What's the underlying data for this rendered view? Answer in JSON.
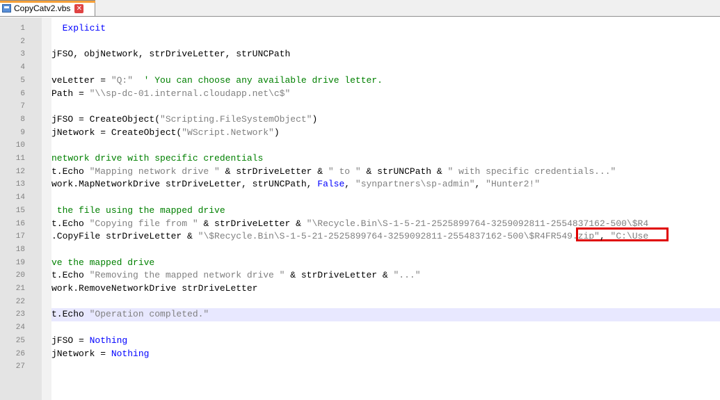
{
  "tab": {
    "filename": "CopyCatv2.vbs",
    "close_glyph": "✕"
  },
  "colors": {
    "keyword": "#0000ff",
    "string": "#808080",
    "comment": "#008000",
    "highlight_box": "#e00000",
    "current_line": "#e8e8ff"
  },
  "editor": {
    "current_line_number": 23,
    "line_numbers": [
      "1",
      "2",
      "3",
      "4",
      "5",
      "6",
      "7",
      "8",
      "9",
      "10",
      "11",
      "12",
      "13",
      "14",
      "15",
      "16",
      "17",
      "18",
      "19",
      "20",
      "21",
      "22",
      "23",
      "24",
      "25",
      "26",
      "27"
    ],
    "lines": [
      [
        {
          "t": "  Explicit",
          "c": "kw"
        }
      ],
      [],
      [
        {
          "t": "jFSO, objNetwork, strDriveLetter, strUNCPath",
          "c": ""
        }
      ],
      [],
      [
        {
          "t": "veLetter = ",
          "c": ""
        },
        {
          "t": "\"Q:\"",
          "c": "str"
        },
        {
          "t": "  ' You can choose any available drive letter.",
          "c": "cmt"
        }
      ],
      [
        {
          "t": "Path = ",
          "c": ""
        },
        {
          "t": "\"\\\\sp-dc-01.internal.cloudapp.net\\c$\"",
          "c": "str"
        }
      ],
      [],
      [
        {
          "t": "jFSO = CreateObject(",
          "c": ""
        },
        {
          "t": "\"Scripting.FileSystemObject\"",
          "c": "str"
        },
        {
          "t": ")",
          "c": ""
        }
      ],
      [
        {
          "t": "jNetwork = CreateObject(",
          "c": ""
        },
        {
          "t": "\"WScript.Network\"",
          "c": "str"
        },
        {
          "t": ")",
          "c": ""
        }
      ],
      [],
      [
        {
          "t": "network drive with specific credentials",
          "c": "cmt"
        }
      ],
      [
        {
          "t": "t.Echo ",
          "c": ""
        },
        {
          "t": "\"Mapping network drive \"",
          "c": "str"
        },
        {
          "t": " & strDriveLetter & ",
          "c": ""
        },
        {
          "t": "\" to \"",
          "c": "str"
        },
        {
          "t": " & strUNCPath & ",
          "c": ""
        },
        {
          "t": "\" with specific credentials...\"",
          "c": "str"
        }
      ],
      [
        {
          "t": "work.MapNetworkDrive strDriveLetter, strUNCPath, ",
          "c": ""
        },
        {
          "t": "False",
          "c": "kw"
        },
        {
          "t": ", ",
          "c": ""
        },
        {
          "t": "\"synpartners\\sp-admin\"",
          "c": "str"
        },
        {
          "t": ", ",
          "c": ""
        },
        {
          "t": "\"Hunter2!\"",
          "c": "str"
        }
      ],
      [],
      [
        {
          "t": " the file using the mapped drive",
          "c": "cmt"
        }
      ],
      [
        {
          "t": "t.Echo ",
          "c": ""
        },
        {
          "t": "\"Copying file from \"",
          "c": "str"
        },
        {
          "t": " & strDriveLetter & ",
          "c": ""
        },
        {
          "t": "\"\\Recycle.Bin\\S-1-5-21-2525899764-3259092811-2554837162-500\\$R4",
          "c": "str"
        }
      ],
      [
        {
          "t": ".CopyFile strDriveLetter & ",
          "c": ""
        },
        {
          "t": "\"\\$Recycle.Bin\\S-1-5-21-2525899764-3259092811-2554837162-500\\$R4FR549.zip\"",
          "c": "str"
        },
        {
          "t": ", ",
          "c": ""
        },
        {
          "t": "\"C:\\Use",
          "c": "str"
        }
      ],
      [],
      [
        {
          "t": "ve the mapped drive",
          "c": "cmt"
        }
      ],
      [
        {
          "t": "t.Echo ",
          "c": ""
        },
        {
          "t": "\"Removing the mapped network drive \"",
          "c": "str"
        },
        {
          "t": " & strDriveLetter & ",
          "c": ""
        },
        {
          "t": "\"...\"",
          "c": "str"
        }
      ],
      [
        {
          "t": "work.RemoveNetworkDrive strDriveLetter",
          "c": ""
        }
      ],
      [],
      [
        {
          "t": "t.Echo ",
          "c": ""
        },
        {
          "t": "\"Operation completed.\"",
          "c": "str"
        }
      ],
      [],
      [
        {
          "t": "jFSO = ",
          "c": ""
        },
        {
          "t": "Nothing",
          "c": "kw"
        }
      ],
      [
        {
          "t": "jNetwork = ",
          "c": ""
        },
        {
          "t": "Nothing",
          "c": "kw"
        }
      ],
      []
    ]
  }
}
